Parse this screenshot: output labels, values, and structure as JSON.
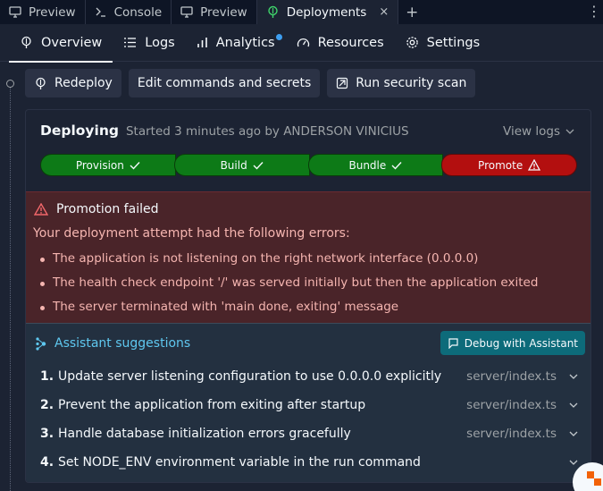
{
  "tabs": [
    {
      "label": "Preview",
      "icon": "monitor-icon"
    },
    {
      "label": "Console",
      "icon": "terminal-icon"
    },
    {
      "label": "Preview",
      "icon": "monitor-icon"
    },
    {
      "label": "Deployments",
      "icon": "deployments-icon",
      "active": true,
      "close": "×"
    }
  ],
  "tab_add": "+",
  "kebab": "⋮",
  "subnav": [
    {
      "label": "Overview",
      "icon": "deployments-icon",
      "active": true
    },
    {
      "label": "Logs",
      "icon": "list-icon"
    },
    {
      "label": "Analytics",
      "icon": "bar-chart-icon",
      "badge_dot": true
    },
    {
      "label": "Resources",
      "icon": "gauge-icon"
    },
    {
      "label": "Settings",
      "icon": "gear-icon"
    }
  ],
  "actions": {
    "redeploy": "Redeploy",
    "edit": "Edit commands and secrets",
    "scan": "Run security scan"
  },
  "deploy": {
    "status": "Deploying",
    "meta": "Started 3 minutes ago by ANDERSON VINICIUS",
    "view_logs": "View logs"
  },
  "pipeline": [
    {
      "label": "Provision",
      "state": "ok"
    },
    {
      "label": "Build",
      "state": "ok"
    },
    {
      "label": "Bundle",
      "state": "ok"
    },
    {
      "label": "Promote",
      "state": "fail"
    }
  ],
  "error": {
    "title": "Promotion failed",
    "intro": "Your deployment attempt had the following errors:",
    "items": [
      "The application is not listening on the right network interface (0.0.0.0)",
      "The health check endpoint '/' was served initially but then the application exited",
      "The server terminated with 'main done, exiting' message"
    ]
  },
  "assistant": {
    "title": "Assistant suggestions",
    "debug_button": "Debug with Assistant",
    "suggestions": [
      {
        "num": "1.",
        "text": "Update server listening configuration to use 0.0.0.0 explicitly",
        "file": "server/index.ts"
      },
      {
        "num": "2.",
        "text": "Prevent the application from exiting after startup",
        "file": "server/index.ts"
      },
      {
        "num": "3.",
        "text": "Handle database initialization errors gracefully",
        "file": "server/index.ts"
      },
      {
        "num": "4.",
        "text": "Set NODE_ENV environment variable in the run command",
        "file": ""
      }
    ]
  },
  "colors": {
    "background": "#1c2333",
    "tabbar": "#0e1525",
    "success": "#0d7a17",
    "failure": "#b30f0f",
    "error_panel": "#4a2429",
    "assistant_accent": "#5fc8f0",
    "debug_button": "#0d6b7a",
    "analytics_dot": "#3d9ef0"
  }
}
